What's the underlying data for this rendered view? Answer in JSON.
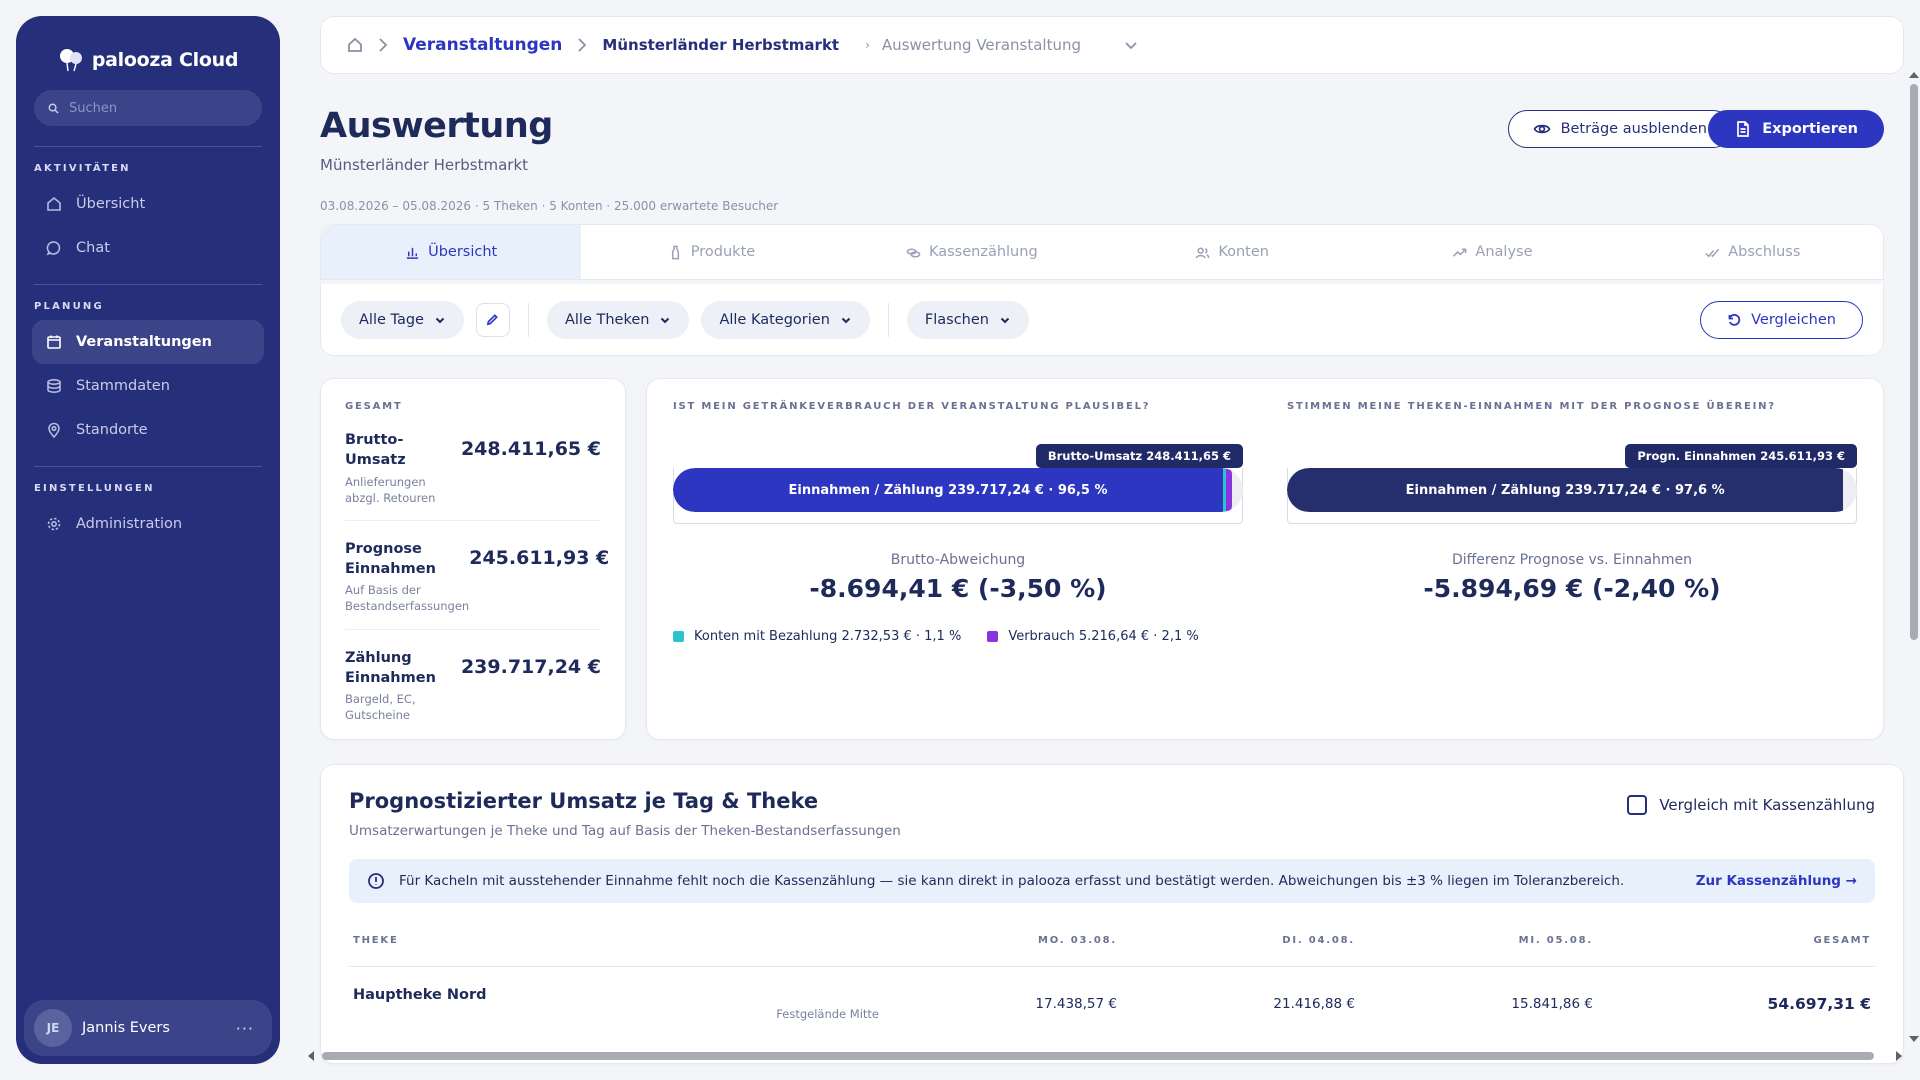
{
  "app": {
    "name": "palooza Cloud"
  },
  "sidebar": {
    "search_placeholder": "Suchen",
    "sections": [
      {
        "label": "AKTIVITÄTEN",
        "items": [
          {
            "label": "Übersicht",
            "icon": "home-icon"
          },
          {
            "label": "Chat",
            "icon": "chat-icon"
          }
        ]
      },
      {
        "label": "PLANUNG",
        "items": [
          {
            "label": "Veranstaltungen",
            "icon": "calendar-icon",
            "active": true
          },
          {
            "label": "Stammdaten",
            "icon": "database-icon"
          },
          {
            "label": "Standorte",
            "icon": "location-icon"
          }
        ]
      },
      {
        "label": "EINSTELLUNGEN",
        "items": [
          {
            "label": "Administration",
            "icon": "gear-icon"
          }
        ]
      }
    ],
    "user": {
      "initials": "JE",
      "name": "Jannis Evers",
      "menu": "···"
    }
  },
  "breadcrumb": {
    "level1": "Veranstaltungen",
    "level2": "Münsterländer Herbstmarkt",
    "current": "Auswertung Veranstaltung"
  },
  "header": {
    "title": "Auswertung",
    "subtitle": "Münsterländer Herbstmarkt",
    "meta": "03.08.2026 – 05.08.2026 · 5 Theken · 5 Konten · 25.000 erwartete Besucher",
    "hide_button": "Beträge ausblenden",
    "export_button": "Exportieren"
  },
  "tabs": [
    {
      "label": "Übersicht",
      "icon": "bar-chart-icon",
      "active": true
    },
    {
      "label": "Produkte",
      "icon": "bottle-icon"
    },
    {
      "label": "Kassenzählung",
      "icon": "coins-icon"
    },
    {
      "label": "Konten",
      "icon": "users-icon"
    },
    {
      "label": "Analyse",
      "icon": "trend-icon"
    },
    {
      "label": "Abschluss",
      "icon": "check-icon"
    }
  ],
  "filters": {
    "days": "Alle Tage",
    "counters": "Alle Theken",
    "categories": "Alle Kategorien",
    "unit": "Flaschen",
    "compare": "Vergleichen"
  },
  "summary": {
    "label": "GESAMT",
    "rows": [
      {
        "title": "Brutto-Umsatz",
        "note": "Anlieferungen abzgl. Retouren",
        "value": "248.411,65 €"
      },
      {
        "title": "Prognose Einnahmen",
        "note": "Auf Basis der Bestandserfassungen",
        "value": "245.611,93 €"
      },
      {
        "title": "Zählung Einnahmen",
        "note": "Bargeld, EC, Gutscheine",
        "value": "239.717,24 €"
      }
    ]
  },
  "plausibility": [
    {
      "label": "IST MEIN GETRÄNKEVERBRAUCH DER VERANSTALTUNG PLAUSIBEL?",
      "tip": "Brutto-Umsatz 248.411,65 €",
      "bar_label": "Einnahmen / Zählung 239.717,24 € · 96,5 %",
      "fill_percent": 96.5,
      "fill_color": "#2c36c0",
      "segments": [
        {
          "percent": 1.1,
          "color": "#2bc4cc"
        },
        {
          "percent": 2.1,
          "color": "#8a34e0"
        }
      ],
      "sub": "Brutto-Abweichung",
      "value": "-8.694,41 € (-3,50 %)",
      "legend": [
        {
          "label": "Konten mit Bezahlung 2.732,53 € · 1,1 %",
          "color": "#2bc4cc"
        },
        {
          "label": "Verbrauch 5.216,64 € · 2,1 %",
          "color": "#8a34e0"
        }
      ]
    },
    {
      "label": "STIMMEN MEINE THEKEN-EINNAHMEN MIT DER PROGNOSE ÜBEREIN?",
      "tip": "Progn. Einnahmen 245.611,93 €",
      "bar_label": "Einnahmen / Zählung 239.717,24 € · 97,6 %",
      "fill_percent": 97.6,
      "fill_color": "#262f6e",
      "segments": [],
      "sub": "Differenz Prognose vs. Einnahmen",
      "value": "-5.894,69 € (-2,40 %)",
      "legend": []
    }
  ],
  "forecast": {
    "title": "Prognostizierter Umsatz je Tag & Theke",
    "subtitle": "Umsatzerwartungen je Theke und Tag auf Basis der Theken-Bestandserfassungen",
    "checkbox_label": "Vergleich mit Kassenzählung",
    "info_text": "Für Kacheln mit ausstehender Einnahme fehlt noch die Kassenzählung — sie kann direkt in palooza erfasst und bestätigt werden. Abweichungen bis ±3 % liegen im Toleranzbereich.",
    "info_link": "Zur Kassenzählung →",
    "columns": [
      "THEKE",
      "MO. 03.08.",
      "DI. 04.08.",
      "MI. 05.08.",
      "GESAMT"
    ],
    "rows": [
      {
        "name": "Hauptheke Nord",
        "location": "Festgelände Mitte",
        "mo": "17.438,57 €",
        "di": "21.416,88 €",
        "mi": "15.841,86 €",
        "total": "54.697,31 €"
      }
    ]
  }
}
